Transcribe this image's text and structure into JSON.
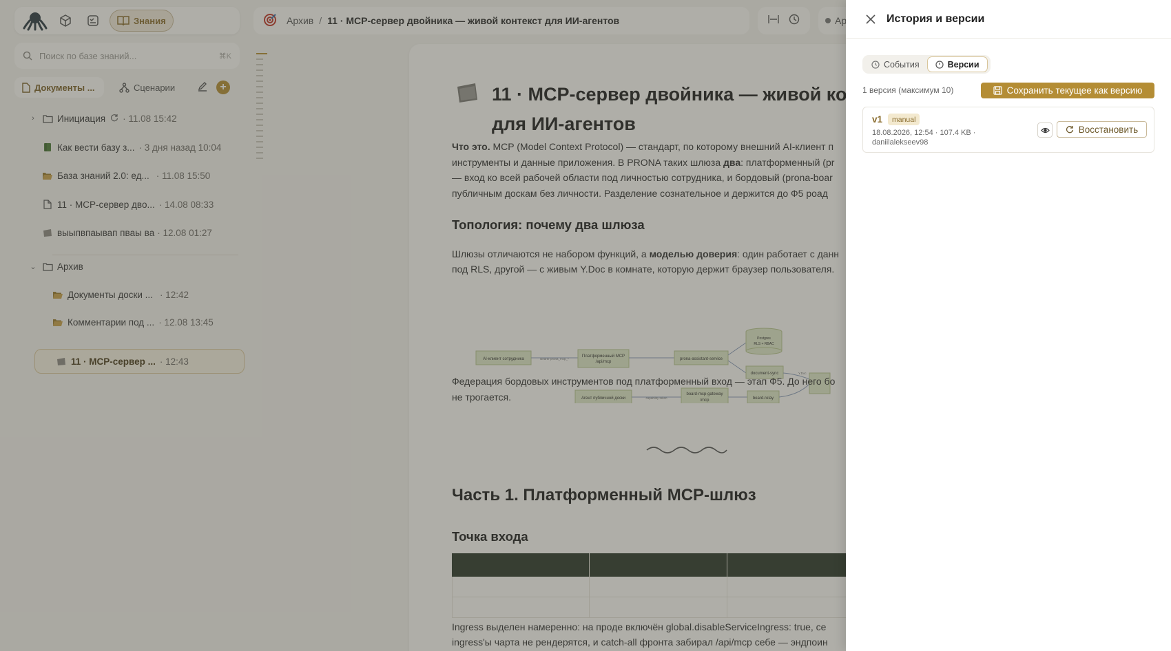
{
  "app": {
    "knowledge_label": "Знания"
  },
  "search": {
    "placeholder": "Поиск по базе знаний...",
    "shortcut": "⌘K"
  },
  "sidebar": {
    "tab_documents": "Документы ...",
    "tab_scenarios": "Сценарии",
    "tree": [
      {
        "label": "Инициация",
        "meta": "· 11.08 15:42",
        "type": "folder",
        "expanded": false
      },
      {
        "label": "Как вести базу з...",
        "meta": "· 3 дня назад 10:04",
        "type": "book"
      },
      {
        "label": "База знаний 2.0: ед...",
        "meta": "· 11.08 15:50",
        "type": "folder-open"
      },
      {
        "label": "11 · MCP-сервер дво...",
        "meta": "· 14.08 08:33",
        "type": "doc"
      },
      {
        "label": "выыпвпаывап пвaы вa",
        "meta": "· 12.08 01:27",
        "type": "card"
      },
      {
        "label": "Архив",
        "meta": "",
        "type": "folder",
        "expanded": true
      },
      {
        "label": "Документы доски ...",
        "meta": "· 12:42",
        "type": "folder-open"
      },
      {
        "label": "Комментарии под ...",
        "meta": "· 12.08 13:45",
        "type": "folder-open"
      },
      {
        "label": "11 · MCP-сервер ...",
        "meta": "· 12:43",
        "type": "card",
        "selected": true
      }
    ]
  },
  "breadcrumb": {
    "parent": "Архив",
    "separator": "/",
    "current": "11 · MCP-сервер двойника — живой контекст для ИИ-агентов",
    "right_clip": "Ар"
  },
  "document": {
    "title_line1": "11 · MCP-сервер двойника — живой ко",
    "title_line2": "для ИИ-агентов",
    "p1_l1_bold": "Что это.",
    "p1_l1": " MCP (Model Context Protocol) — стандарт, по которому внешний AI-клиент п",
    "p1_l2a": "инструменты и данные приложения. В PRONA таких шлюза ",
    "p1_l2b": "два",
    "p1_l2c": ": платформенный (pr",
    "p1_l3": "— вход ко всей рабочей области под личностью сотрудника, и бордовый (prona-boar",
    "p1_l4": "публичным доскам без личности. Разделение сознательное и держится до Ф5 роад",
    "h_topology": "Топология: почему два шлюза",
    "p2_l1a": "Шлюзы отличаются не набором функций, а ",
    "p2_l1b": "моделью доверия",
    "p2_l1c": ": один работает с данн",
    "p2_l2": "под RLS, другой — с живым Y.Doc в комнате, которую держит браузер пользователя.",
    "diagram": {
      "n1": "AI-клиент сотрудника",
      "e1": "Bearer prona_mcp_*",
      "n2a": "Платформенный MCP",
      "n2b": "/api/mcp",
      "n3": "prona-assistant-service",
      "n4a": "Postgres",
      "n4b": "RLS + RBAC",
      "n5": "document-sync",
      "e5": "Y.Doc",
      "n6": "Агент публичной доски",
      "e6": "capability token",
      "n7a": "board-mcp-gateway",
      "n7b": "/mcp",
      "n8": "board-relay"
    },
    "p3_l1": "Федерация бордовых инструментов под платформенный вход — этап Ф5. До него бо",
    "p3_l2": "не трогается.",
    "h_part1": "Часть 1. Платформенный MCP-шлюз",
    "h_entry": "Точка входа",
    "p4_l1": "Ingress выделен намеренно: на проде включён global.disableServiceIngress: true, се",
    "p4_l2": "ingress'ы чарта не рендерятся, и catch-all фронта забирал /api/mcp себе — эндпоин"
  },
  "history_panel": {
    "title": "История и версии",
    "tab_events": "События",
    "tab_versions": "Версии",
    "version_count": "1 версия (максимум 10)",
    "save_button": "Сохранить текущее как версию",
    "versions": [
      {
        "name": "v1",
        "badge": "manual",
        "meta_line1": "18.08.2026, 12:54 · 107.4 KB ·",
        "meta_line2": "daniilalekseev98",
        "restore_label": "Восстановить"
      }
    ]
  },
  "colors": {
    "accent": "#b48d35",
    "overlay": "rgba(70,68,60,0.42)",
    "table_header": "#2e3a2c"
  }
}
